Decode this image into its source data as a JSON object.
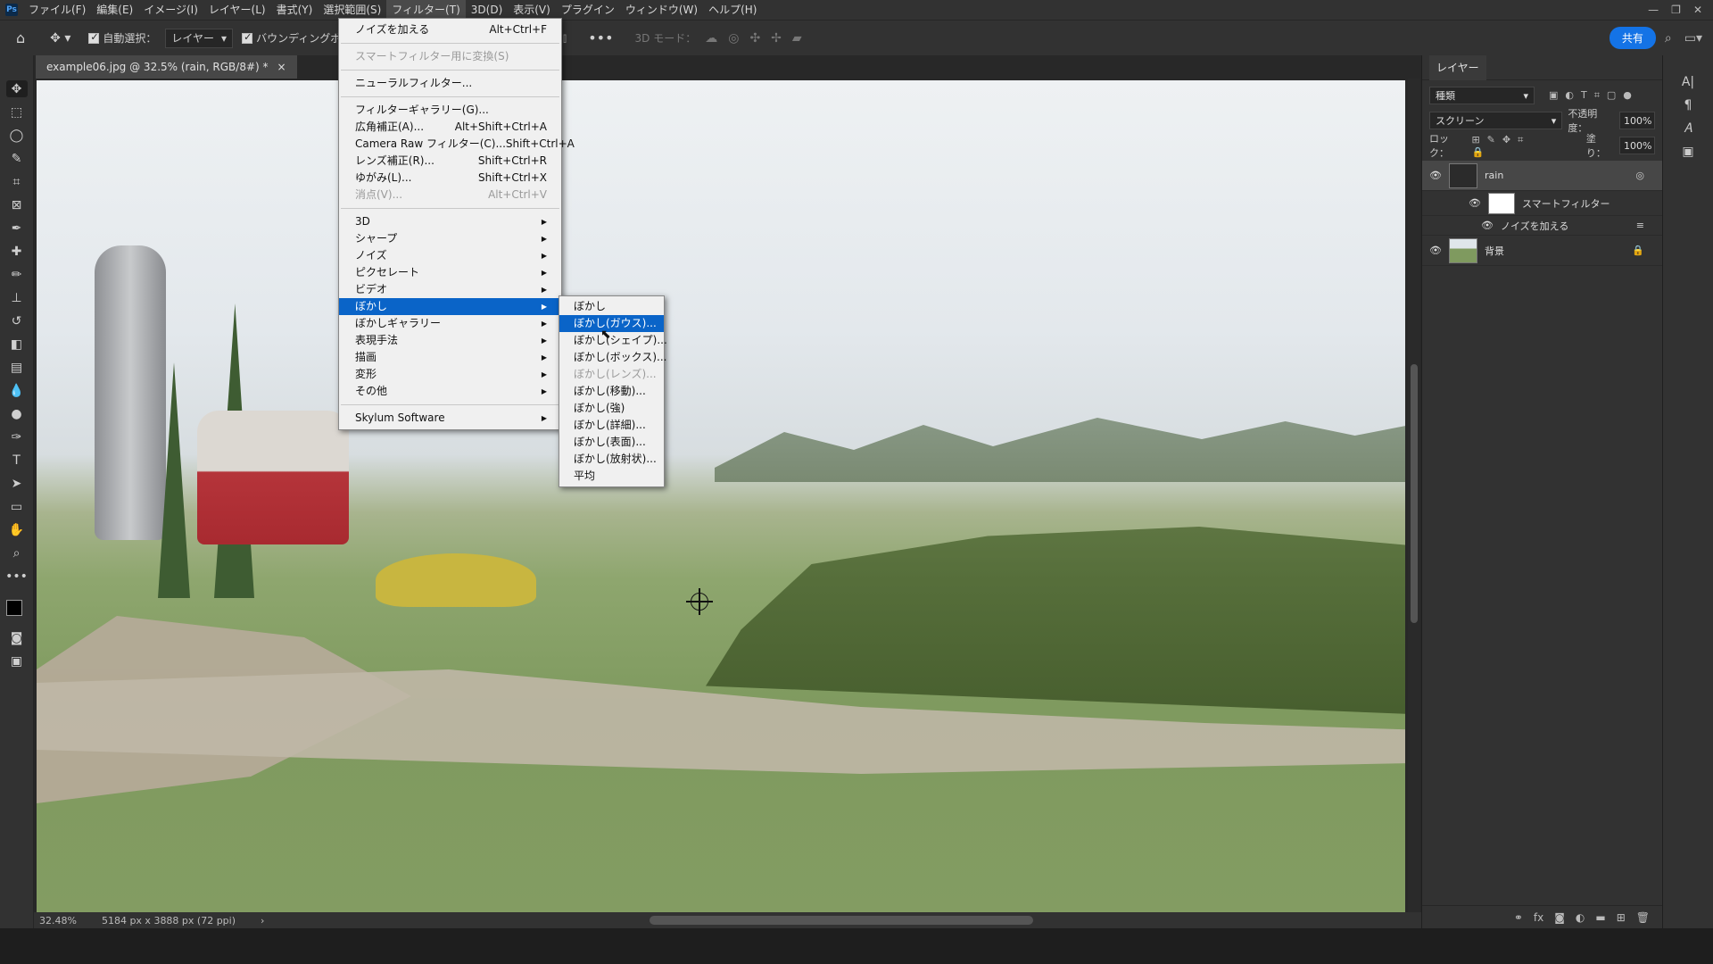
{
  "menubar": {
    "logo": "Ps",
    "items": [
      "ファイル(F)",
      "編集(E)",
      "イメージ(I)",
      "レイヤー(L)",
      "書式(Y)",
      "選択範囲(S)",
      "フィルター(T)",
      "3D(D)",
      "表示(V)",
      "プラグイン",
      "ウィンドウ(W)",
      "ヘルプ(H)"
    ],
    "window_controls": [
      "—",
      "❐",
      "✕"
    ]
  },
  "options_bar": {
    "auto_select_label": "自動選択：",
    "auto_select_value": "レイヤー",
    "bounding_label": "バウンディングボ",
    "mode_3d_label": "3D モード：",
    "share_label": "共有"
  },
  "document": {
    "tab_title": "example06.jpg @ 32.5% (rain, RGB/8#) *",
    "tab_close": "×",
    "zoom": "32.48%",
    "dimensions": "5184 px x 3888 px (72 ppi)"
  },
  "filter_menu": {
    "items": [
      {
        "label": "ノイズを加える",
        "shortcut": "Alt+Ctrl+F",
        "state": "normal"
      },
      {
        "sep": true
      },
      {
        "label": "スマートフィルター用に変換(S)",
        "shortcut": "",
        "state": "disabled"
      },
      {
        "sep": true
      },
      {
        "label": "ニューラルフィルター...",
        "shortcut": "",
        "state": "normal"
      },
      {
        "sep": true
      },
      {
        "label": "フィルターギャラリー(G)...",
        "shortcut": "",
        "state": "normal"
      },
      {
        "label": "広角補正(A)...",
        "shortcut": "Alt+Shift+Ctrl+A",
        "state": "normal"
      },
      {
        "label": "Camera Raw フィルター(C)...",
        "shortcut": "Shift+Ctrl+A",
        "state": "normal"
      },
      {
        "label": "レンズ補正(R)...",
        "shortcut": "Shift+Ctrl+R",
        "state": "normal"
      },
      {
        "label": "ゆがみ(L)...",
        "shortcut": "Shift+Ctrl+X",
        "state": "normal"
      },
      {
        "label": "消点(V)...",
        "shortcut": "Alt+Ctrl+V",
        "state": "disabled"
      },
      {
        "sep": true
      },
      {
        "label": "3D",
        "submenu": true,
        "state": "normal"
      },
      {
        "label": "シャープ",
        "submenu": true,
        "state": "normal"
      },
      {
        "label": "ノイズ",
        "submenu": true,
        "state": "normal"
      },
      {
        "label": "ピクセレート",
        "submenu": true,
        "state": "normal"
      },
      {
        "label": "ビデオ",
        "submenu": true,
        "state": "normal"
      },
      {
        "label": "ぼかし",
        "submenu": true,
        "state": "highlight"
      },
      {
        "label": "ぼかしギャラリー",
        "submenu": true,
        "state": "normal"
      },
      {
        "label": "表現手法",
        "submenu": true,
        "state": "normal"
      },
      {
        "label": "描画",
        "submenu": true,
        "state": "normal"
      },
      {
        "label": "変形",
        "submenu": true,
        "state": "normal"
      },
      {
        "label": "その他",
        "submenu": true,
        "state": "normal"
      },
      {
        "sep": true
      },
      {
        "label": "Skylum Software",
        "submenu": true,
        "state": "normal"
      }
    ]
  },
  "blur_submenu": {
    "items": [
      {
        "label": "ぼかし",
        "state": "normal"
      },
      {
        "label": "ぼかし(ガウス)...",
        "state": "highlight"
      },
      {
        "label": "ぼかし(シェイプ)...",
        "state": "normal"
      },
      {
        "label": "ぼかし(ボックス)...",
        "state": "normal"
      },
      {
        "label": "ぼかし(レンズ)...",
        "state": "disabled"
      },
      {
        "label": "ぼかし(移動)...",
        "state": "normal"
      },
      {
        "label": "ぼかし(強)",
        "state": "normal"
      },
      {
        "label": "ぼかし(詳細)...",
        "state": "normal"
      },
      {
        "label": "ぼかし(表面)...",
        "state": "normal"
      },
      {
        "label": "ぼかし(放射状)...",
        "state": "normal"
      },
      {
        "label": "平均",
        "state": "normal"
      }
    ]
  },
  "layers_panel": {
    "tab_label": "レイヤー",
    "filter_kind": "種類",
    "blend_mode": "スクリーン",
    "opacity_label": "不透明度：",
    "opacity_value": "100%",
    "lock_label": "ロック：",
    "fill_label": "塗り：",
    "fill_value": "100%",
    "layers": [
      {
        "name": "rain",
        "selected": true
      },
      {
        "name": "スマートフィルター",
        "sub": true
      },
      {
        "name": "ノイズを加える",
        "sub2": true
      },
      {
        "name": "背景",
        "locked": true
      }
    ]
  },
  "colors": {
    "menu_highlight": "#0a64c8",
    "share_button": "#1473e6",
    "ui_dark": "#323232"
  }
}
